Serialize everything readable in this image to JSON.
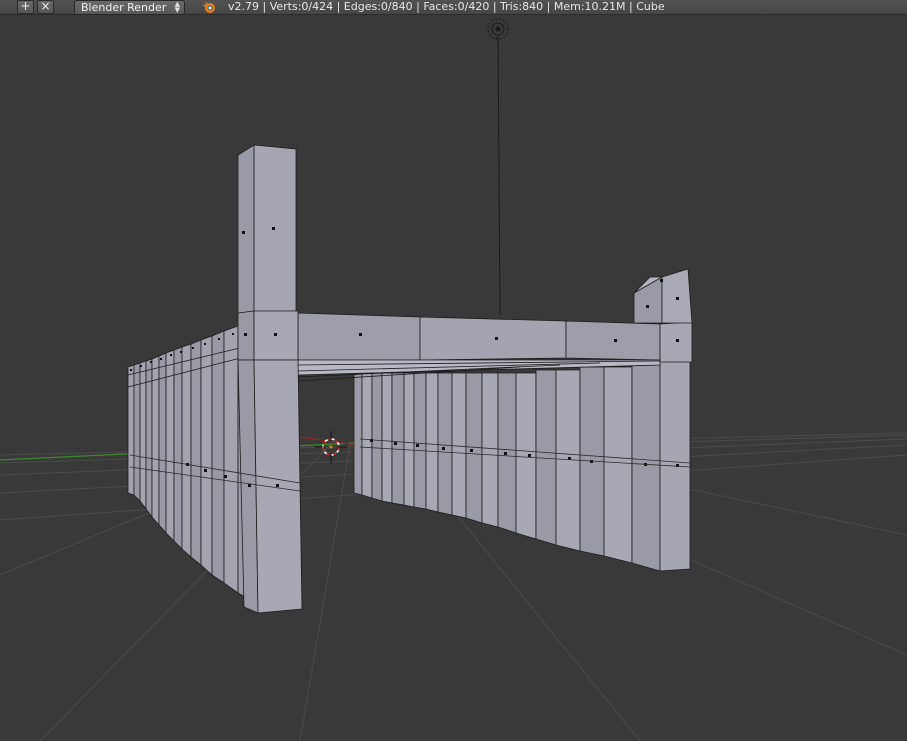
{
  "header": {
    "add_glyph": "+",
    "close_glyph": "×",
    "render_engine": "Blender Render",
    "stats": "v2.79 | Verts:0/424 | Edges:0/840 | Faces:0/420 | Tris:840 | Mem:10.21M | Cube",
    "logo_icon": "blender-logo-icon"
  },
  "viewport": {
    "background": "#393939",
    "mesh_face": "#9c9ca8",
    "mesh_face_dark": "#8a8a96",
    "wire": "#1a1a1a",
    "x_axis": "#a02020",
    "y_axis": "#3c8c28",
    "grid": "#4a4a4a",
    "icons": [
      "lamp-icon",
      "3d-cursor-icon"
    ]
  }
}
